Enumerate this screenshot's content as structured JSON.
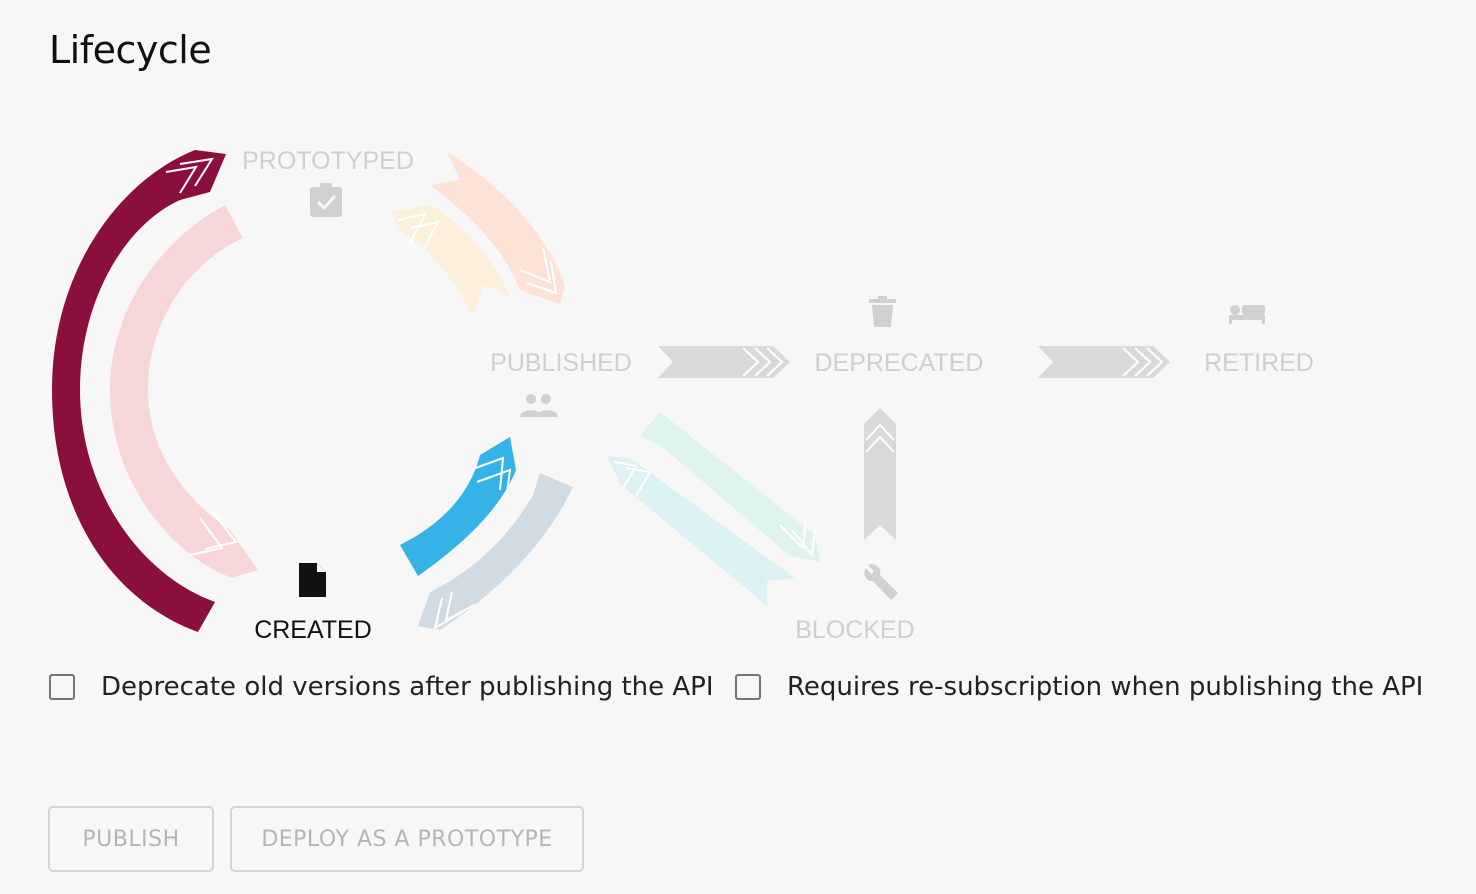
{
  "page": {
    "title": "Lifecycle"
  },
  "lifecycle": {
    "stages": {
      "prototyped": "PROTOTYPED",
      "published": "PUBLISHED",
      "deprecated": "DEPRECATED",
      "retired": "RETIRED",
      "created": "CREATED",
      "blocked": "BLOCKED"
    },
    "current_stage": "CREATED",
    "icons": {
      "prototyped": "clipboard-check-icon",
      "published": "people-icon",
      "deprecated": "trash-icon",
      "retired": "bed-icon",
      "created": "document-icon",
      "blocked": "wrench-icon"
    },
    "colors": {
      "created_to_prototyped": "#8b0f3c",
      "prototyped_to_created": "#f7d6d9",
      "prototyped_to_published": "#fce3d6",
      "published_to_prototyped": "#fcefdc",
      "created_to_published": "#36b3e6",
      "published_to_created": "#d0dbe3",
      "published_to_blocked": "#ddf3ec",
      "blocked_to_published": "#dcf1f3",
      "inactive_arrow": "#d9d9d9",
      "inactive_text": "#cfcfcf",
      "active_text": "#111111"
    }
  },
  "options": {
    "deprecate_old_versions": {
      "label": "Deprecate old versions after publishing the API",
      "checked": false
    },
    "require_resubscription": {
      "label": "Requires re-subscription when publishing the API",
      "checked": false
    }
  },
  "actions": {
    "publish_label": "PUBLISH",
    "deploy_prototype_label": "DEPLOY AS A PROTOTYPE"
  }
}
